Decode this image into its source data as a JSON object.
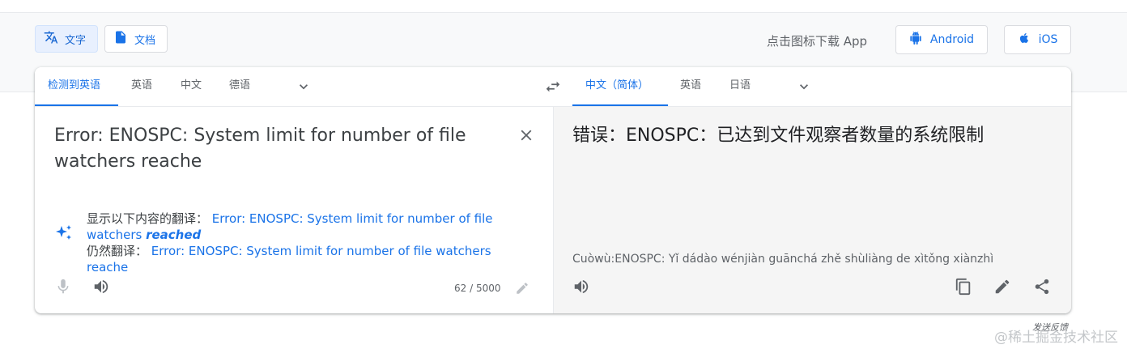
{
  "modes": [
    {
      "label": "文字",
      "icon": "translate-icon",
      "active": true
    },
    {
      "label": "文档",
      "icon": "document-icon",
      "active": false
    }
  ],
  "download": {
    "label": "点击图标下载 App",
    "android_label": "Android",
    "ios_label": "iOS"
  },
  "source_langs": {
    "tabs": [
      "检测到英语",
      "英语",
      "中文",
      "德语"
    ]
  },
  "target_langs": {
    "tabs": [
      "中文（简体）",
      "英语",
      "日语"
    ]
  },
  "source": {
    "text": "Error: ENOSPC: System limit for number of file watchers reache",
    "char_count": "62 / 5000",
    "suggestion": {
      "prefix": "显示以下内容的翻译：",
      "text_before": "Error: ENOSPC: System limit for number of file watchers",
      "emphasis": "reached",
      "alt_prefix": "仍然翻译：",
      "alt_text": "Error: ENOSPC: System limit for number of file watchers reache"
    }
  },
  "target": {
    "text": "错误：ENOSPC：已达到文件观察者数量的系统限制",
    "romanization": "Cuòwù:ENOSPC: Yǐ dádào wénjiàn guānchá zhě shùliàng de xìtǒng xiànzhì"
  },
  "footer": {
    "feedback": "发送反馈",
    "watermark": "@稀土掘金技术社区"
  },
  "colors": {
    "accent": "#1a73e8",
    "text": "#3c4043",
    "muted": "#5f6368",
    "pane": "#f5f5f5"
  }
}
